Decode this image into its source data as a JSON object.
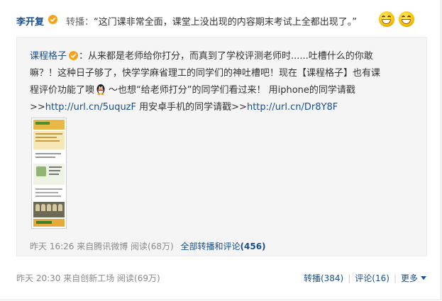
{
  "post": {
    "author": "李开复",
    "verb": "转播：",
    "text": "“这门课非常全面，课堂上没出现的内容期末考试上全都出现了。”",
    "emojis": [
      "grin-emoji",
      "grin-emoji"
    ],
    "verified_badge_color": "#f7a21b"
  },
  "original": {
    "author": "课程格子",
    "line1_text": "：从来都是老师给你打分，而真到了学校评测老师时......吐槽什么的你敢",
    "line2": "嘛？！这种日子够了，快学学麻省理工的同学们的神吐槽吧！现在【课程格子】也有课",
    "line3_before_icon": "程评价功能了噢",
    "line3_after_icon": "～也想“给老师打分”的同学们看过来！ 用iphone的同学请戳",
    "line4_prefix": ">>",
    "link1": "http://url.cn/5uquzF",
    "line4_mid": " 用安卓手机的同学请戳>>",
    "link2": "http://url.cn/Dr8Y8F",
    "meta_time": "昨天 16:26 来自腾讯微博 阅读(68万)",
    "all_relay_label": "全部转播和评论",
    "all_relay_count": "(456)"
  },
  "footer": {
    "time_source": "昨天 20:30 来自创新工场 阅读(69万)",
    "relay": "转播(384)",
    "comment": "评论(16)",
    "more": "更多"
  },
  "colors": {
    "link": "#1a4f8a",
    "meta": "#8a8a8a",
    "quote_bg": "#f5f5f5"
  }
}
